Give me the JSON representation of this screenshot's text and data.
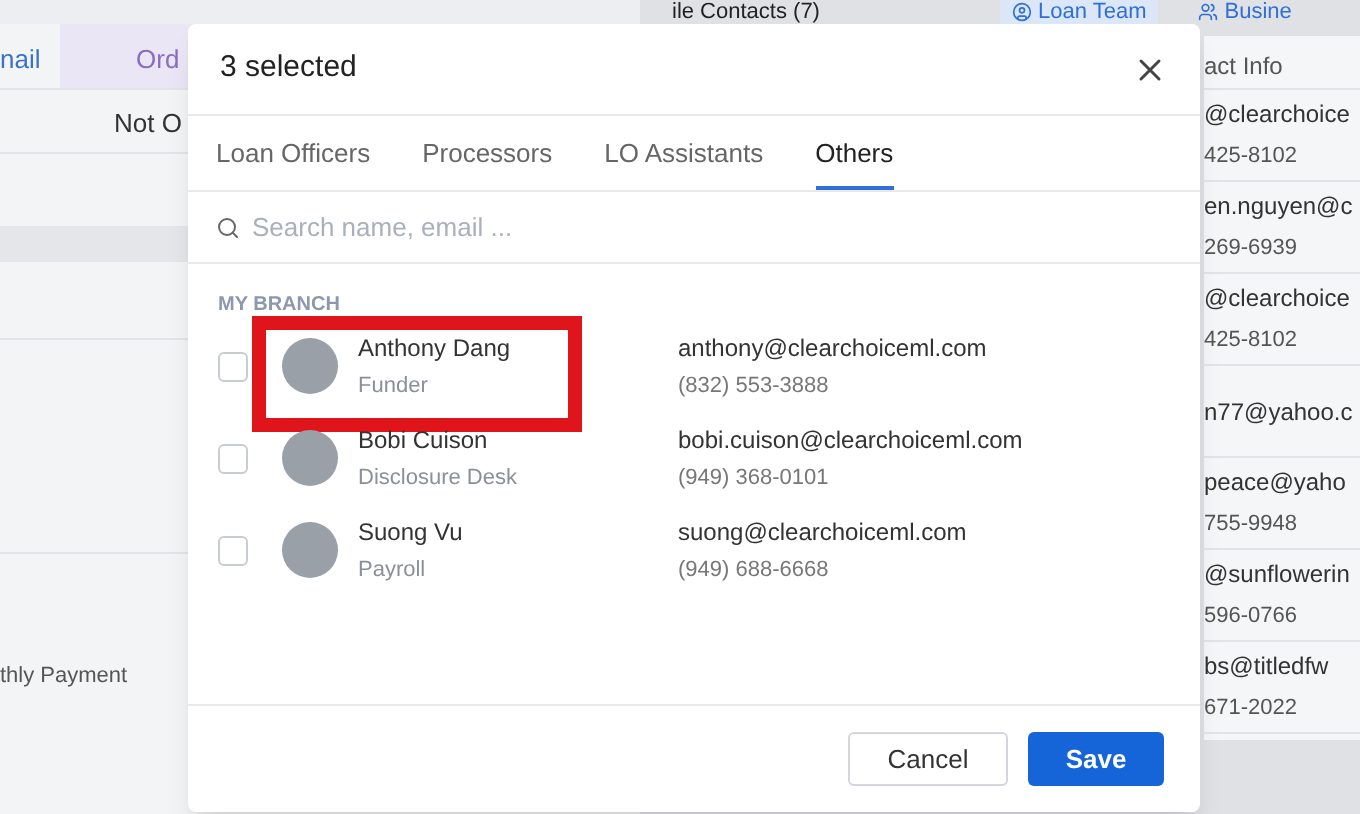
{
  "background": {
    "left_panel": {
      "header_cells": [
        {
          "text": "nail",
          "kind": "link"
        },
        {
          "text": "Ord",
          "kind": "column"
        }
      ],
      "cell": "Not O",
      "label": "thly Payment"
    },
    "right_panel": {
      "title": "ile Contacts (7)",
      "tabs": [
        {
          "label": "Loan Team",
          "selected": true
        },
        {
          "label": "Busine",
          "selected": false
        }
      ],
      "column": "act Info",
      "rows": [
        {
          "line_1": "@clearchoice",
          "line_2": "425-8102"
        },
        {
          "line_1": "en.nguyen@c",
          "line_2": "269-6939"
        },
        {
          "line_1": "@clearchoice",
          "line_2": "425-8102"
        },
        {
          "line_1": "n77@yahoo.c"
        },
        {
          "line_1": "peace@yaho",
          "line_2": "755-9948"
        },
        {
          "line_1": "@sunflowerin",
          "line_2": "596-0766"
        },
        {
          "line_1": "bs@titledfw",
          "line_2": "671-2022"
        }
      ]
    }
  },
  "dialog": {
    "title": "3 selected",
    "tabs": [
      {
        "label": "Loan Officers",
        "selected": false
      },
      {
        "label": "Processors",
        "selected": false
      },
      {
        "label": "LO Assistants",
        "selected": false
      },
      {
        "label": "Others",
        "selected": true
      }
    ],
    "search": {
      "placeholder": "Search name, email ..."
    },
    "section": "MY BRANCH",
    "people": [
      {
        "name": "Anthony Dang",
        "role": "Funder",
        "email": "anthony@clearchoiceml.com",
        "phone": "(832) 553-3888",
        "checked": false,
        "highlighted": true
      },
      {
        "name": "Bobi Cuison",
        "role": "Disclosure Desk",
        "email": "bobi.cuison@clearchoiceml.com",
        "phone": "(949) 368-0101",
        "checked": false,
        "highlighted": false
      },
      {
        "name": "Suong Vu",
        "role": "Payroll",
        "email": "suong@clearchoiceml.com",
        "phone": "(949) 688-6668",
        "checked": false,
        "highlighted": false
      }
    ],
    "buttons": [
      {
        "label": "Cancel",
        "kind": "secondary"
      },
      {
        "label": "Save",
        "kind": "primary"
      }
    ]
  }
}
